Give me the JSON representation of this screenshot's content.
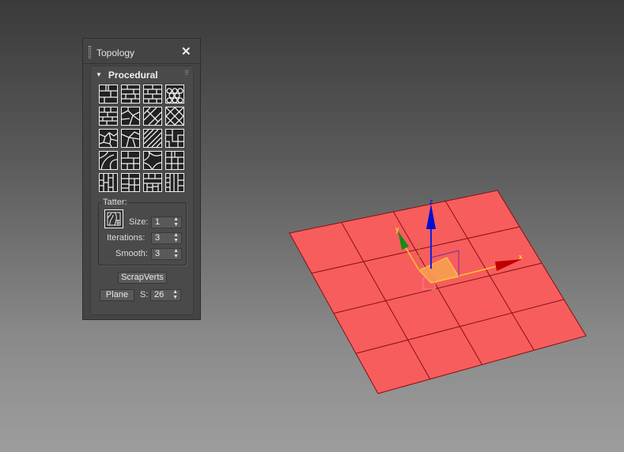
{
  "panel": {
    "title": "Topology",
    "close_icon": "close-icon",
    "rollout": {
      "title": "Procedural",
      "tile_count": 20,
      "tatter": {
        "label": "Tatter:",
        "size_label": "Size:",
        "size_value": "1",
        "iterations_label": "Iterations:",
        "iterations_value": "3",
        "smooth_label": "Smooth:",
        "smooth_value": "3"
      },
      "scrapverts_label": "ScrapVerts",
      "plane_label": "Plane",
      "s_label": "S:",
      "s_value": "26"
    }
  },
  "viewport": {
    "plane_color": "#f75d5d",
    "grid_segments": 4,
    "gizmo": {
      "x_label": "x",
      "y_label": "y",
      "z_label": "z",
      "x_color": "#cc0000",
      "y_color": "#1a8a1a",
      "z_color": "#0000cc"
    }
  }
}
